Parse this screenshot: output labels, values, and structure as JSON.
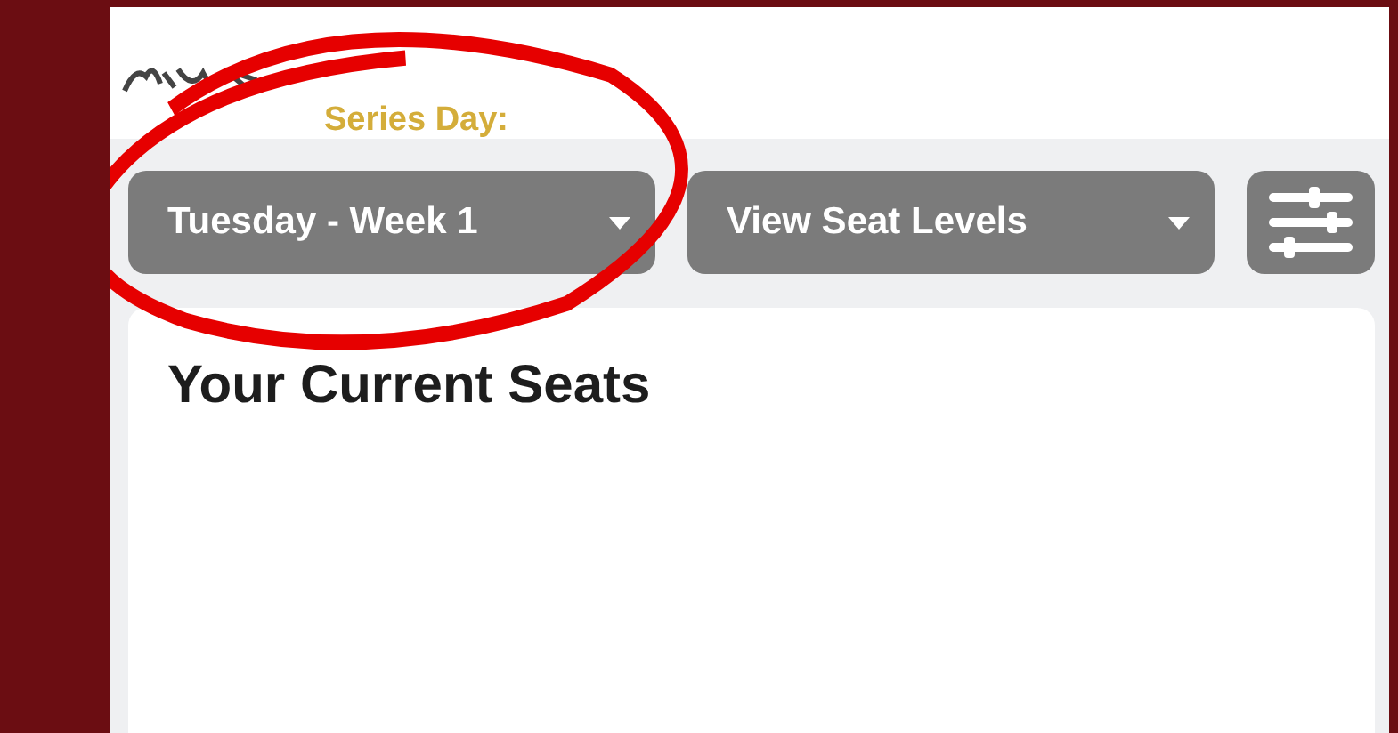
{
  "series_day_label": "Series Day:",
  "dropdowns": [
    {
      "label": "Tuesday - Week 1"
    },
    {
      "label": "View Seat Levels"
    }
  ],
  "card": {
    "title": "Your Current Seats"
  }
}
